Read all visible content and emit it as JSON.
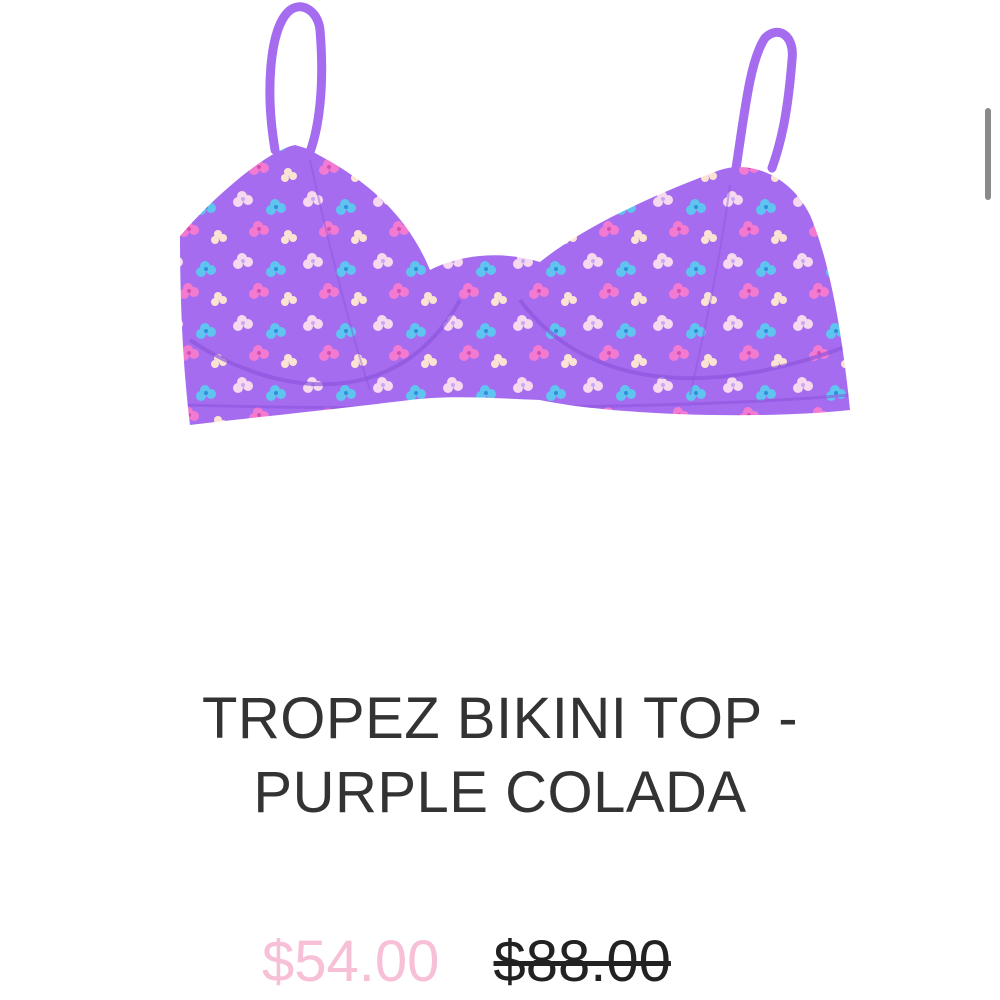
{
  "product": {
    "title_line1": "TROPEZ BIKINI TOP -",
    "title_line2": "PURPLE COLADA",
    "sale_price": "$54.00",
    "original_price": "$88.00",
    "image_icon": "bikini-top-image"
  },
  "colors": {
    "fabric": "#a56cf0",
    "sale_price": "#f7c0d7",
    "title": "#333333"
  }
}
